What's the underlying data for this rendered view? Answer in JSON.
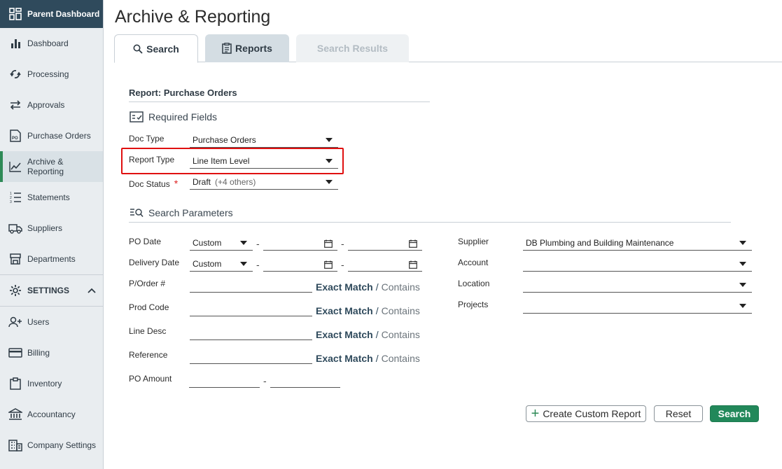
{
  "sidebar": {
    "header": "Parent Dashboard",
    "items": [
      {
        "label": "Dashboard",
        "icon": "bar-chart-icon"
      },
      {
        "label": "Processing",
        "icon": "sync-icon"
      },
      {
        "label": "Approvals",
        "icon": "arrows-swap-icon"
      },
      {
        "label": "Purchase Orders",
        "icon": "po-document-icon"
      },
      {
        "label": "Archive & Reporting",
        "label_line1": "Archive &",
        "label_line2": "Reporting",
        "icon": "line-chart-icon",
        "active": true
      },
      {
        "label": "Statements",
        "icon": "numbered-list-icon"
      },
      {
        "label": "Suppliers",
        "icon": "truck-icon"
      },
      {
        "label": "Departments",
        "icon": "store-icon"
      }
    ],
    "settings": "SETTINGS",
    "settings_items": [
      {
        "label": "Users",
        "icon": "add-user-icon"
      },
      {
        "label": "Billing",
        "icon": "credit-card-icon"
      },
      {
        "label": "Inventory",
        "icon": "clipboard-icon"
      },
      {
        "label": "Accountancy",
        "icon": "bank-icon"
      },
      {
        "label": "Company Settings",
        "icon": "building-icon"
      }
    ]
  },
  "page_title": "Archive & Reporting",
  "tabs": {
    "search": "Search",
    "reports": "Reports",
    "results": "Search Results"
  },
  "report_title": "Report: Purchase Orders",
  "required": {
    "heading": "Required Fields",
    "doc_type": {
      "label": "Doc Type",
      "value": "Purchase Orders"
    },
    "report_type": {
      "label": "Report Type",
      "value": "Line Item Level"
    },
    "doc_status": {
      "label": "Doc Status",
      "required_mark": "*",
      "value": "Draft",
      "extra": "(+4 others)"
    }
  },
  "params": {
    "heading": "Search Parameters",
    "po_date": {
      "label": "PO Date",
      "value": "Custom"
    },
    "delivery_date": {
      "label": "Delivery Date",
      "value": "Custom"
    },
    "po_number": {
      "label": "P/Order #"
    },
    "prod_code": {
      "label": "Prod Code"
    },
    "line_desc": {
      "label": "Line Desc"
    },
    "reference": {
      "label": "Reference"
    },
    "po_amount": {
      "label": "PO Amount"
    },
    "dash": "-",
    "exact": "Exact Match",
    "slash": "/",
    "contains": "Contains",
    "supplier": {
      "label": "Supplier",
      "value": "DB Plumbing and Building Maintenance"
    },
    "account": {
      "label": "Account",
      "value": ""
    },
    "location": {
      "label": "Location",
      "value": ""
    },
    "projects": {
      "label": "Projects",
      "value": ""
    }
  },
  "buttons": {
    "custom_plus": "+",
    "custom": "Create Custom Report",
    "reset": "Reset",
    "search": "Search"
  },
  "colors": {
    "sidebar_header": "#2f4a5c",
    "accent_green": "#22885a",
    "highlight_red": "#e01010"
  }
}
